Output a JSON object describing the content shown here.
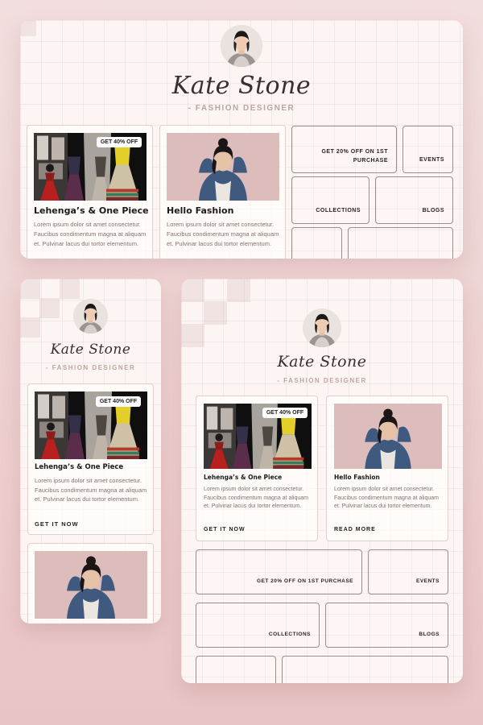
{
  "profile": {
    "name": "Kate Stone",
    "role": "- FASHION DESIGNER"
  },
  "cards": {
    "lehenga": {
      "title": "Lehenga’s & One Piece",
      "badge": "GET 40% OFF",
      "body": "Lorem ipsum dolor sit amet consectetur. Faucibus condimentum magna at aliquam et. Pulvinar lacus dui tortor elementum.",
      "link": "GET IT NOW"
    },
    "hello": {
      "title": "Hello Fashion",
      "body": "Lorem ipsum dolor sit amet consectetur. Faucibus condimentum magna at aliquam et. Pulvinar lacus dui tortor elementum.",
      "link": "READ MORE"
    }
  },
  "tiles": {
    "offer": "GET 20% OFF ON 1ST PURCHASE",
    "events": "EVENTS",
    "collections": "COLLECTIONS",
    "blogs": "BLOGS"
  },
  "colors": {
    "background": "#efd5d5",
    "panel": "#fdf5f4",
    "text": "#1e1a1a",
    "muted": "#807472",
    "accent": "#b9a6a2"
  },
  "icons": {
    "avatar": "woman-portrait-icon",
    "lehenga_image": "dress-display-photo",
    "hello_image": "woman-denim-jacket-photo"
  }
}
